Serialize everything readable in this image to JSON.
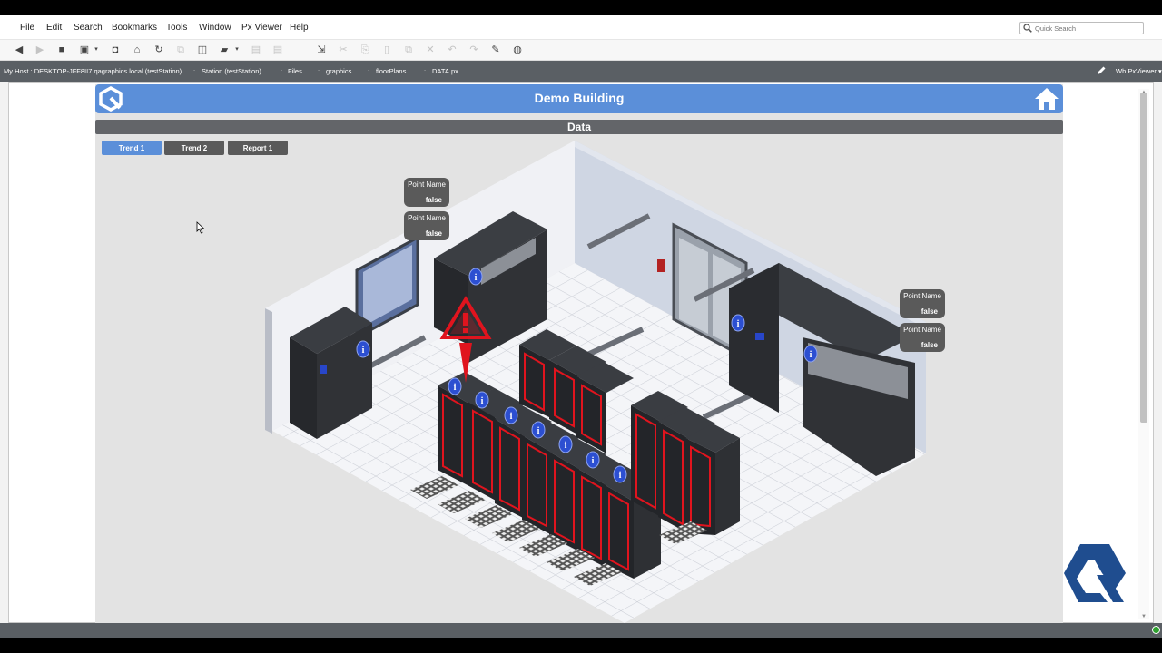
{
  "menu": [
    "File",
    "Edit",
    "Search",
    "Bookmarks",
    "Tools",
    "Window",
    "Px Viewer",
    "Help"
  ],
  "quick_search": {
    "placeholder": "Quick Search"
  },
  "toolbar_icons": [
    "back-icon",
    "forward-icon",
    "folder-icon",
    "split-view-icon",
    "camera-icon",
    "home-icon",
    "refresh-icon",
    "copy-page-icon",
    "sidebar-icon",
    "open-folder-icon",
    "save-icon",
    "save-all-icon",
    "export-icon",
    "cut-icon",
    "copy-icon",
    "paste-icon",
    "duplicate-icon",
    "delete-icon",
    "undo-icon",
    "redo-icon",
    "edit-pen-icon",
    "globe-icon"
  ],
  "breadcrumb": [
    "My Host : DESKTOP-JFF8II7.qagraphics.local (testStation)",
    "Station (testStation)",
    "Files",
    "graphics",
    "floorPlans",
    "DATA.px"
  ],
  "view_selector": "Wb PxViewer",
  "page": {
    "title": "Demo Building",
    "section": "Data",
    "nav": [
      {
        "label": "Trend 1",
        "active": true
      },
      {
        "label": "Trend 2",
        "active": false
      },
      {
        "label": "Report 1",
        "active": false
      }
    ],
    "points": [
      {
        "name": "Point Name",
        "value": "false"
      },
      {
        "name": "Point Name",
        "value": "false"
      },
      {
        "name": "Point Name",
        "value": "false"
      },
      {
        "name": "Point Name",
        "value": "false"
      }
    ]
  },
  "colors": {
    "accent": "#5b8fd9",
    "dark_button": "#5a5a5a",
    "section_bar": "#636569",
    "alarm_red": "#e0141e",
    "info_blue": "#2c4fd1",
    "logo_blue": "#1f4d8f"
  }
}
